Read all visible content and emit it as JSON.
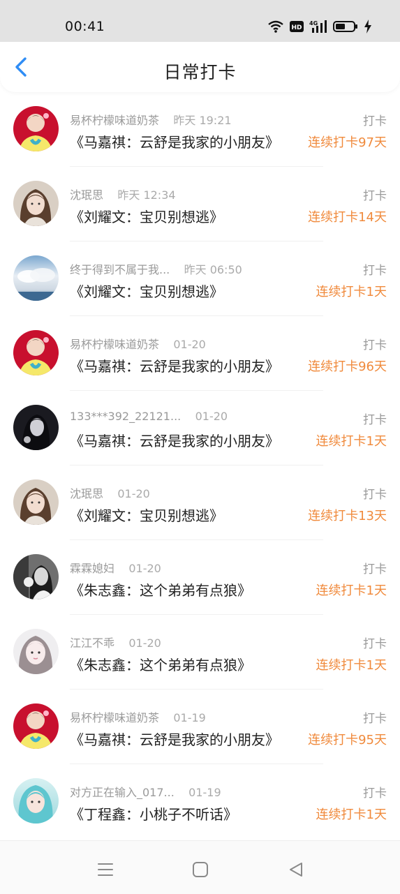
{
  "status_bar": {
    "time": "00:41",
    "icons": [
      "wifi-icon",
      "hd-icon",
      "4g-signal-icon",
      "battery-icon",
      "charging-icon"
    ]
  },
  "header": {
    "title": "日常打卡",
    "back_icon": "chevron-left-icon"
  },
  "colors": {
    "accent": "#2f8df5",
    "streak": "#f08a3c",
    "muted": "#9a9a9a"
  },
  "records": [
    {
      "name": "易杯柠檬味道奶茶",
      "time": "昨天 19:21",
      "title": "《马嘉祺：云舒是我家的小朋友》",
      "label": "打卡",
      "streak": "连续打卡97天",
      "avatar": "red"
    },
    {
      "name": "沈珉思",
      "time": "昨天 12:34",
      "title": "《刘耀文：宝贝别想逃》",
      "label": "打卡",
      "streak": "连续打卡14天",
      "avatar": "girl"
    },
    {
      "name": "终于得到不属于我...",
      "time": "昨天 06:50",
      "title": "《刘耀文：宝贝别想逃》",
      "label": "打卡",
      "streak": "连续打卡1天",
      "avatar": "sky"
    },
    {
      "name": "易杯柠檬味道奶茶",
      "time": "01-20",
      "title": "《马嘉祺：云舒是我家的小朋友》",
      "label": "打卡",
      "streak": "连续打卡96天",
      "avatar": "red"
    },
    {
      "name": "133***392_22121...",
      "time": "01-20",
      "title": "《马嘉祺：云舒是我家的小朋友》",
      "label": "打卡",
      "streak": "连续打卡1天",
      "avatar": "dark"
    },
    {
      "name": "沈珉思",
      "time": "01-20",
      "title": "《刘耀文：宝贝别想逃》",
      "label": "打卡",
      "streak": "连续打卡13天",
      "avatar": "girl"
    },
    {
      "name": "霖霖媳妇",
      "time": "01-20",
      "title": "《朱志鑫：这个弟弟有点狼》",
      "label": "打卡",
      "streak": "连续打卡1天",
      "avatar": "bw"
    },
    {
      "name": "江江不乖",
      "time": "01-20",
      "title": "《朱志鑫：这个弟弟有点狼》",
      "label": "打卡",
      "streak": "连续打卡1天",
      "avatar": "pale"
    },
    {
      "name": "易杯柠檬味道奶茶",
      "time": "01-19",
      "title": "《马嘉祺：云舒是我家的小朋友》",
      "label": "打卡",
      "streak": "连续打卡95天",
      "avatar": "red"
    },
    {
      "name": "对方正在输入_017...",
      "time": "01-19",
      "title": "《丁程鑫：小桃子不听话》",
      "label": "打卡",
      "streak": "连续打卡1天",
      "avatar": "teal"
    }
  ],
  "nav_bar": {
    "icons": [
      "menu-icon",
      "home-square-icon",
      "back-triangle-icon"
    ]
  }
}
